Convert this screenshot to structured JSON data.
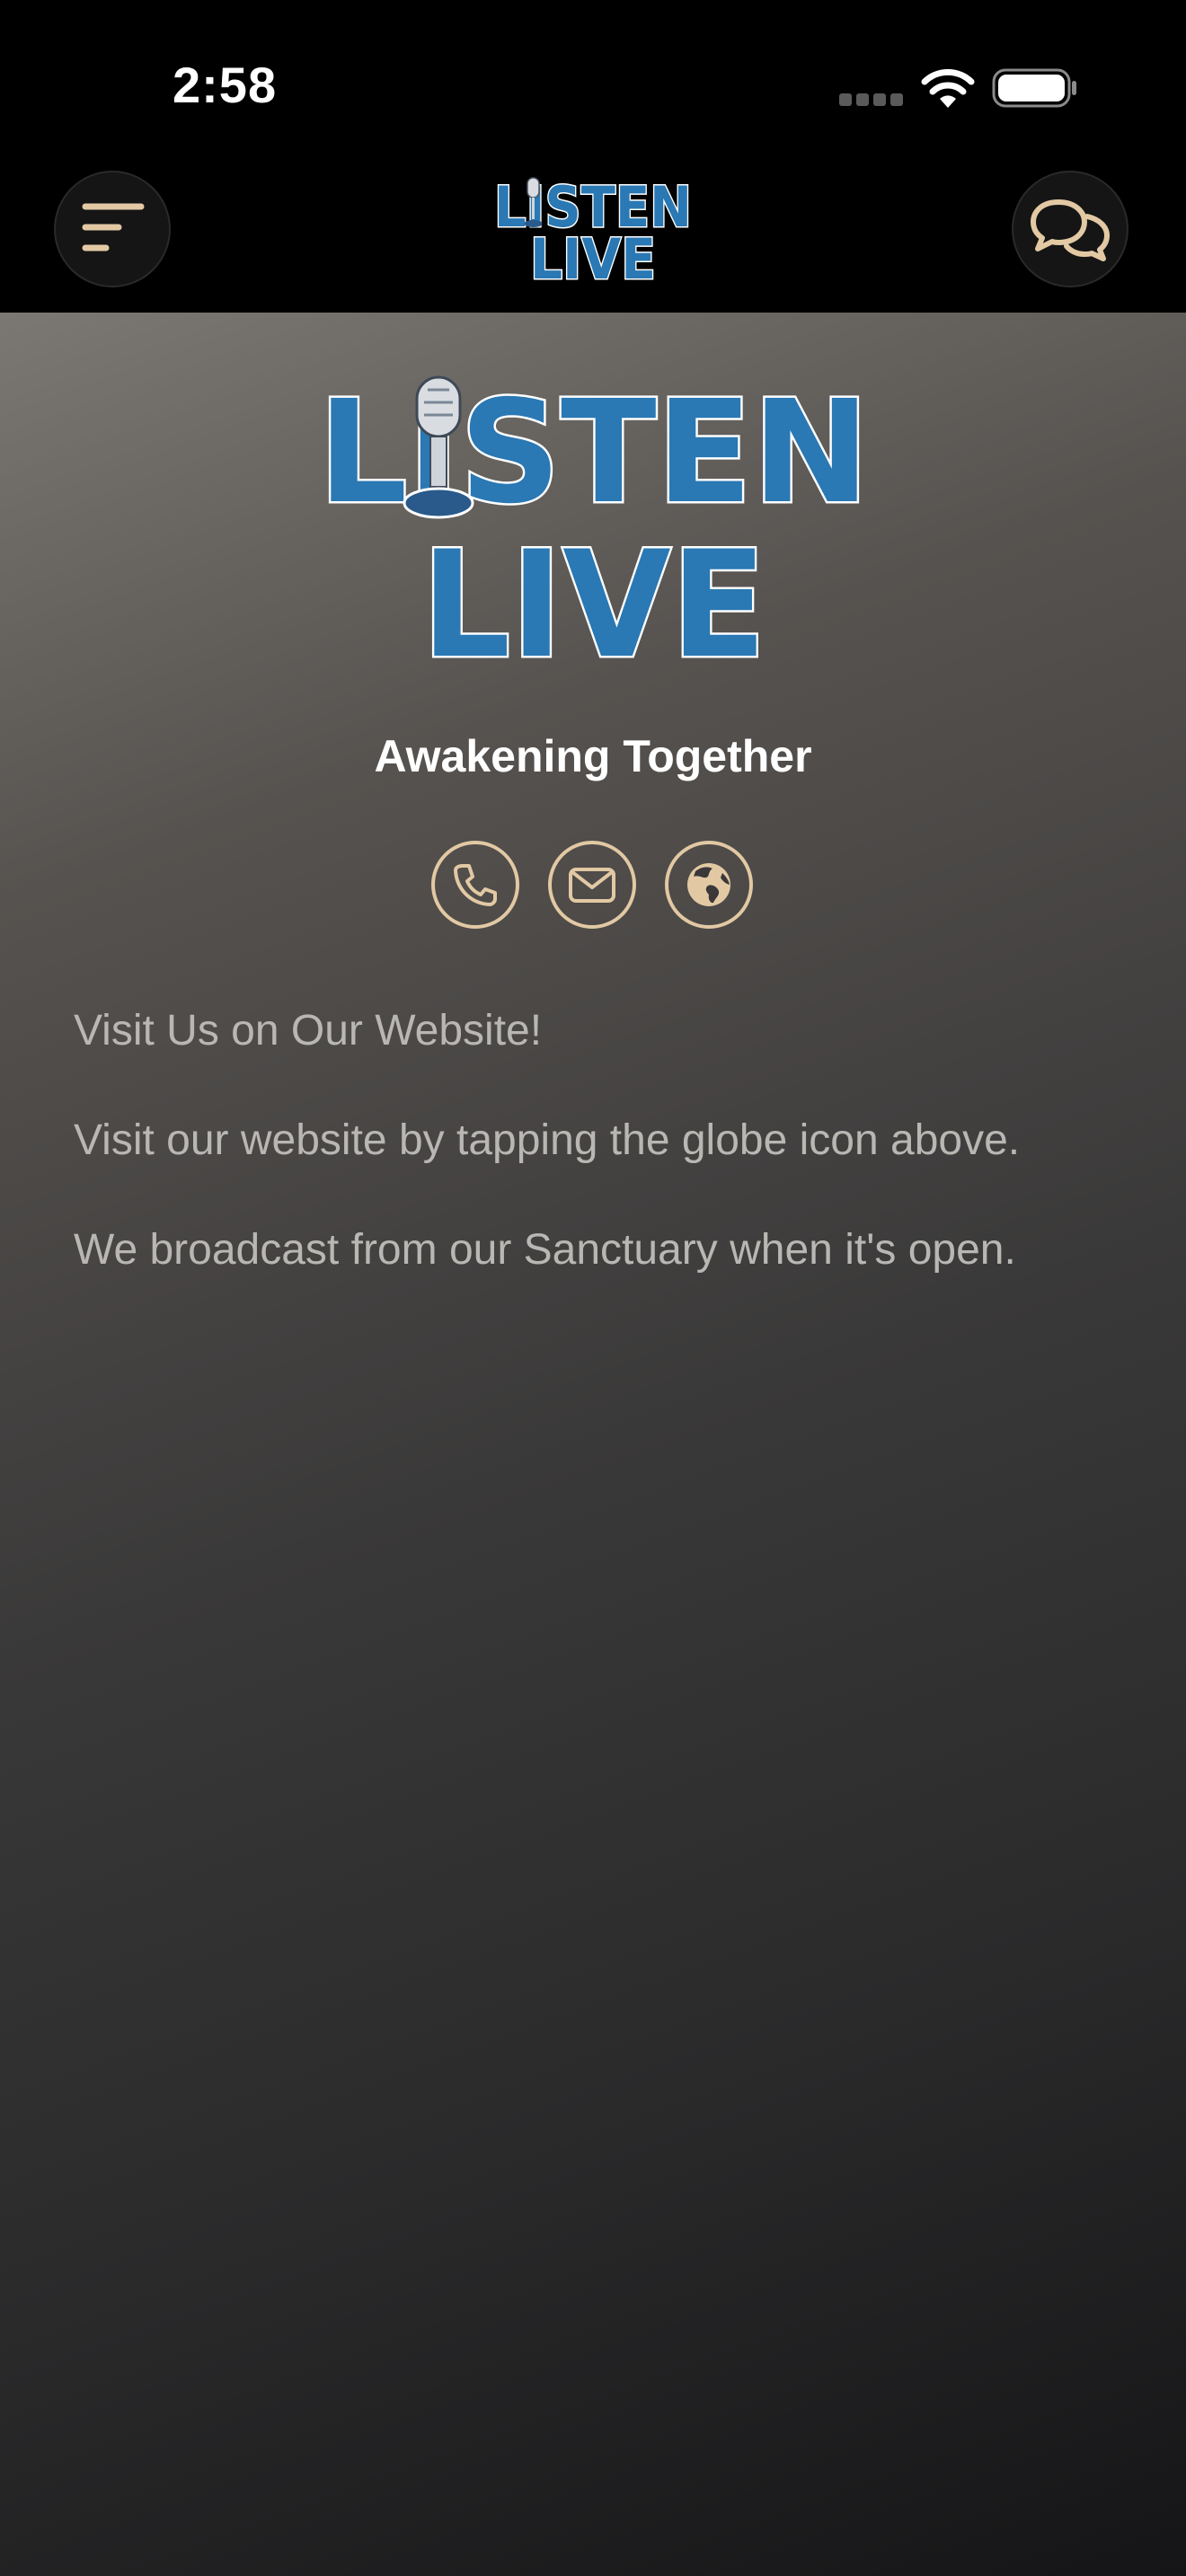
{
  "status_bar": {
    "time": "2:58"
  },
  "nav": {
    "menu_icon": "menu-lines-icon",
    "chat_icon": "chat-bubbles-icon",
    "logo": {
      "line1": "LISTEN",
      "line2": "LIVE"
    }
  },
  "hero": {
    "logo": {
      "line1": "LISTEN",
      "line2": "LIVE"
    },
    "tagline": "Awakening Together"
  },
  "contact": {
    "icons": [
      "phone-icon",
      "email-icon",
      "globe-icon"
    ],
    "accent_color": "#e2c9a4"
  },
  "body": {
    "paragraphs": [
      "Visit Us on Our Website!",
      "Visit our website by tapping the globe icon above.",
      "We broadcast from our Sanctuary when it's open."
    ]
  },
  "colors": {
    "logo_blue": "#2a78b4",
    "icon_accent": "#e2c9a4",
    "text_muted": "#b9b7b3"
  }
}
